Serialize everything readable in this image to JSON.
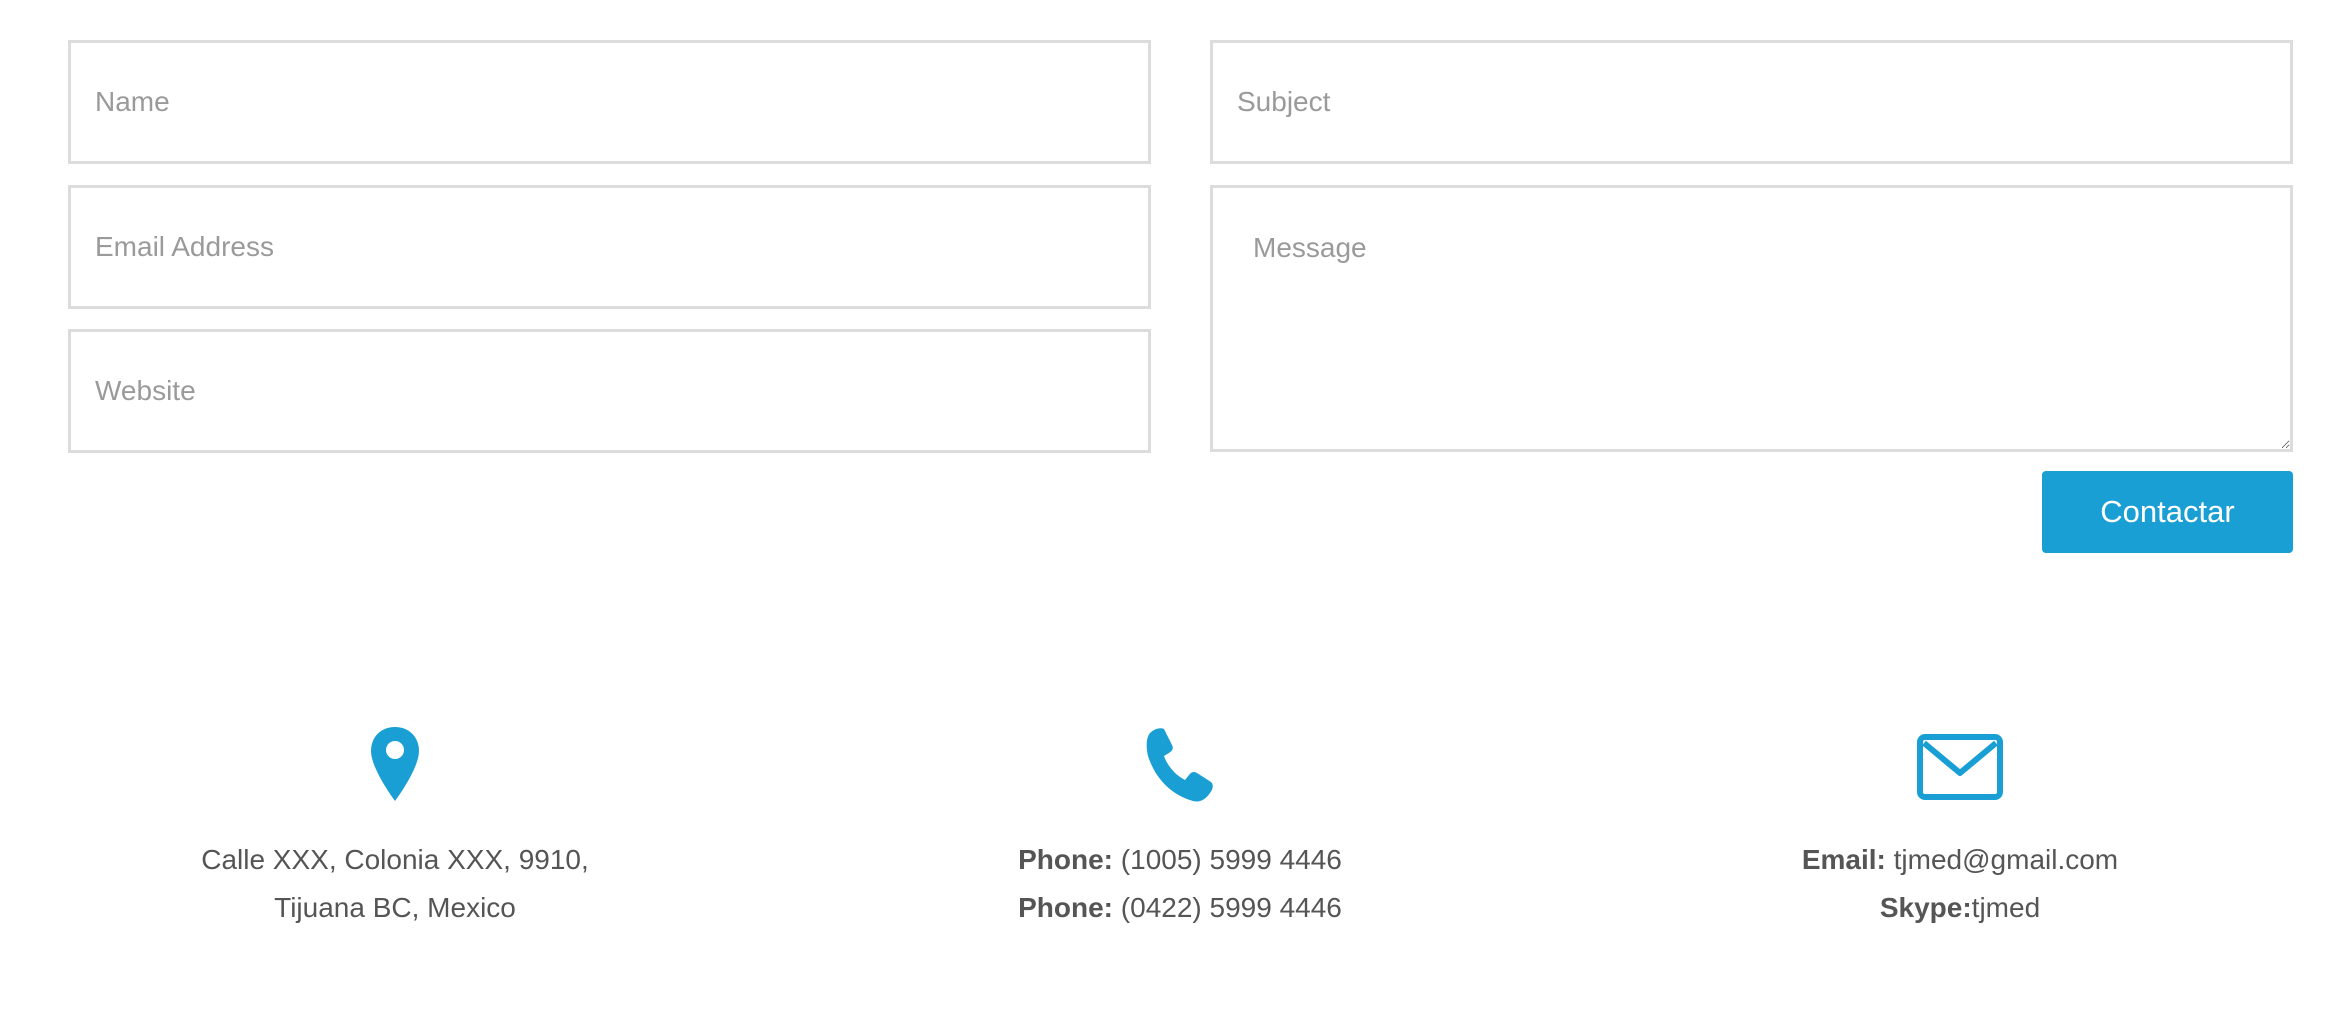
{
  "form": {
    "name_placeholder": "Name",
    "email_placeholder": "Email Address",
    "website_placeholder": "Website",
    "subject_placeholder": "Subject",
    "message_placeholder": "Message",
    "submit_label": "Contactar"
  },
  "contact_info": {
    "address": {
      "icon": "map-pin-icon",
      "line1": "Calle XXX, Colonia XXX, 9910,",
      "line2": "Tijuana BC, Mexico"
    },
    "phone": {
      "icon": "phone-icon",
      "label1": "Phone:",
      "value1": " (1005) 5999 4446",
      "label2": "Phone:",
      "value2": " (0422) 5999 4446"
    },
    "email": {
      "icon": "envelope-icon",
      "email_label": "Email:",
      "email_value": " tjmed@gmail.com",
      "skype_label": "Skype:",
      "skype_value": "tjmed"
    }
  },
  "colors": {
    "accent": "#1a9fd5",
    "text": "#555555",
    "placeholder": "#9a9a9a",
    "border": "#dcdcdc"
  }
}
